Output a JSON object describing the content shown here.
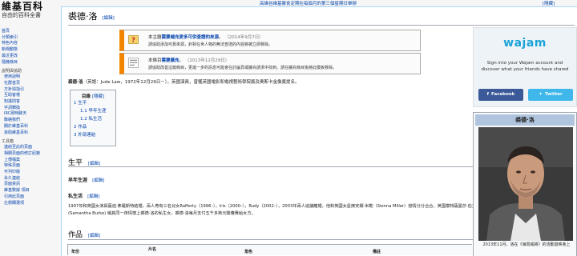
{
  "logo": {
    "title": "維基百科",
    "subtitle": "自由的百科全書"
  },
  "sidebar": {
    "nav": [
      "首頁",
      "分類索引",
      "特色內容",
      "新聞動態",
      "最近更改",
      "隨機條目"
    ],
    "help_header": "說明與協助",
    "help": [
      "使用說明",
      "社群首頁",
      "方針與指引",
      "互助客棧",
      "知識問答",
      "字詞轉換",
      "IRC即時聊天",
      "聯絡我們",
      "關於維基百科",
      "資助維基百科"
    ],
    "tools_header": "工具箱",
    "tools": [
      "連結至此的頁面",
      "相關頁面的修訂紀錄",
      "上傳檔案",
      "特殊頁面",
      "可列印版",
      "永久連結",
      "頁面資訊",
      "維基數據 項目",
      "引用此頁面",
      "左側欄選項"
    ]
  },
  "topbar": {
    "notice": "高雄谷維基聚會定期在每個月的第三個星期日舉辦",
    "hide": "[隱藏]"
  },
  "page": {
    "title": "裘德·洛",
    "edit": "[編輯]"
  },
  "notices": [
    {
      "pre": "本主題",
      "bold": "需要補充更多可供查證的來源",
      "post": "。",
      "date": "（2014年9月7日）",
      "line2": "請協助添加可靠來源，針對在世人物的無法查證的內容將被立即移除。"
    },
    {
      "pre": "本條目",
      "bold": "需要擴充",
      "post": "。",
      "date": "（2013年12月29日）",
      "line2": "請協助改善這篇條目，更進一步的訊息可能會在討論頁或擴充請求中找到。請在擴充條目後將此模板移除。"
    }
  ],
  "lead": {
    "name": "裘德·洛",
    "text": "（英語：Jude Law，1972年12月29日－），英國演員，曾獲英國電影和電視藝術學院獎及奧斯卡金像獎提名。"
  },
  "toc": {
    "title": "目錄",
    "toggle": "[隱藏]",
    "items": [
      "1 生平",
      "1.1 早年生涯",
      "1.2 私生活",
      "2 作品",
      "3 外部連結"
    ]
  },
  "sections": {
    "life": "生平",
    "early": "早年生涯",
    "private": "私生活",
    "private_text": "1997年和英國女演員薩迪·弗羅斯特結婚，兩人育有三名兒女Rafferty（1996–），Iris（2000–），Rudy（2002–），2003年兩人協議離婚，他和英國女星席安娜·米勒（Sienna Miller）戀情分分合合，英國模特薩曼莎·伯克(Samantha Burke) 稱其同一夜情懷上裘德·洛的私生女，裘德·洛每月支付五千多英元贍養費給女方。",
    "works": "作品"
  },
  "table": {
    "headers": [
      "年份",
      "片名",
      "角色",
      "備註"
    ]
  },
  "wajam": {
    "logo": "wajam",
    "line1": "Sign into your Wajam account and",
    "line2": "discover what your friends have shared",
    "facebook": "Facebook",
    "twitter": "Twitter",
    "colors": {
      "facebook": "#3b5998",
      "twitter": "#40b7ea",
      "brand": "#1aa3d8"
    }
  },
  "infobox": {
    "title": "裘德·洛",
    "caption": "2013年11月，洛在《海問威將》的活動首映會上"
  },
  "colors": {
    "link": "#0645ad",
    "notice_border": "#f28500",
    "infobox_title": "#b0c4de"
  }
}
